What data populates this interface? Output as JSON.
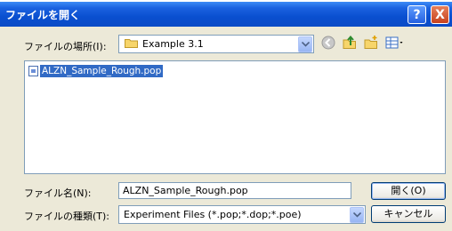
{
  "window": {
    "title": "ファイルを開く"
  },
  "titlebar_buttons": {
    "help": "?",
    "close": "X"
  },
  "location": {
    "label": "ファイルの場所(I):",
    "value": "Example 3.1"
  },
  "toolbar": {
    "icons": [
      "back-icon",
      "up-folder-icon",
      "new-folder-icon",
      "view-menu-icon"
    ]
  },
  "files": [
    {
      "name": "ALZN_Sample_Rough.pop",
      "selected": true
    }
  ],
  "filename": {
    "label": "ファイル名(N):",
    "value": "ALZN_Sample_Rough.pop"
  },
  "filetype": {
    "label": "ファイルの種類(T):",
    "value": "Experiment Files (*.pop;*.dop;*.poe)"
  },
  "buttons": {
    "open": "開く(O)",
    "cancel": "キャンセル"
  },
  "colors": {
    "titlebar": "#0a4fd0",
    "selection": "#316ac5",
    "dialog_bg": "#ece9d8"
  }
}
